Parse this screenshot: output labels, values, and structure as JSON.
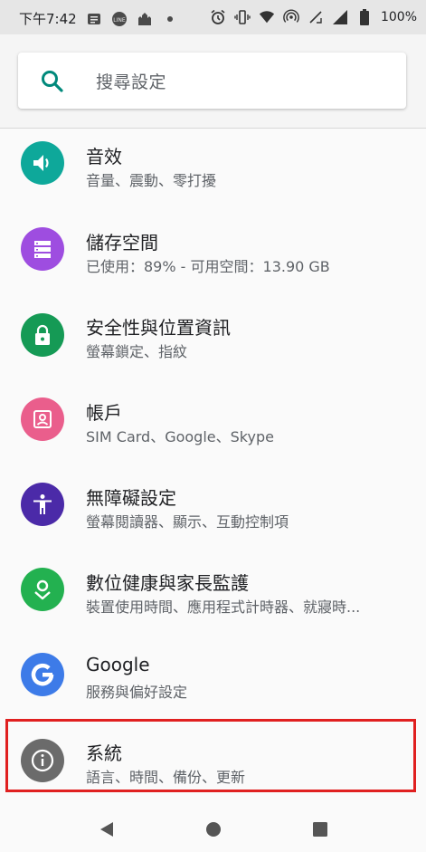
{
  "status_bar": {
    "time": "下午7:42",
    "battery": "100%",
    "left_icons": [
      "notes-icon",
      "line-app-icon",
      "castle-icon",
      "dot-icon"
    ],
    "right_icons": [
      "alarm-icon",
      "vibrate-icon",
      "wifi-icon",
      "hotspot-icon",
      "no-sim-icon",
      "signal-icon",
      "battery-icon"
    ]
  },
  "search": {
    "placeholder": "搜尋設定"
  },
  "settings": [
    {
      "title": "音效",
      "summary": "音量、震動、零打擾",
      "icon": "volume-icon",
      "color": "#0ea89a"
    },
    {
      "title": "儲存空間",
      "summary": "已使用：89% - 可用空間：13.90 GB",
      "icon": "storage-icon",
      "color": "#9e4de0"
    },
    {
      "title": "安全性與位置資訊",
      "summary": "螢幕鎖定、指紋",
      "icon": "lock-icon",
      "color": "#159a55"
    },
    {
      "title": "帳戶",
      "summary": "SIM Card、Google、Skype",
      "icon": "account-icon",
      "color": "#ea5e8c"
    },
    {
      "title": "無障礙設定",
      "summary": "螢幕閱讀器、顯示、互動控制項",
      "icon": "accessibility-icon",
      "color": "#4b2aa8"
    },
    {
      "title": "數位健康與家長監護",
      "summary": "裝置使用時間、應用程式計時器、就寢時...",
      "icon": "wellbeing-icon",
      "color": "#23b150"
    },
    {
      "title": "Google",
      "summary": "服務與偏好設定",
      "icon": "google-icon",
      "color": "#3d7be8"
    },
    {
      "title": "系統",
      "summary": "語言、時間、備份、更新",
      "icon": "info-icon",
      "color": "#6b6b6b"
    }
  ],
  "highlight": {
    "color": "#e02020",
    "target": "系統"
  },
  "nav": {
    "buttons": [
      "back-icon",
      "home-icon",
      "recents-icon"
    ]
  }
}
